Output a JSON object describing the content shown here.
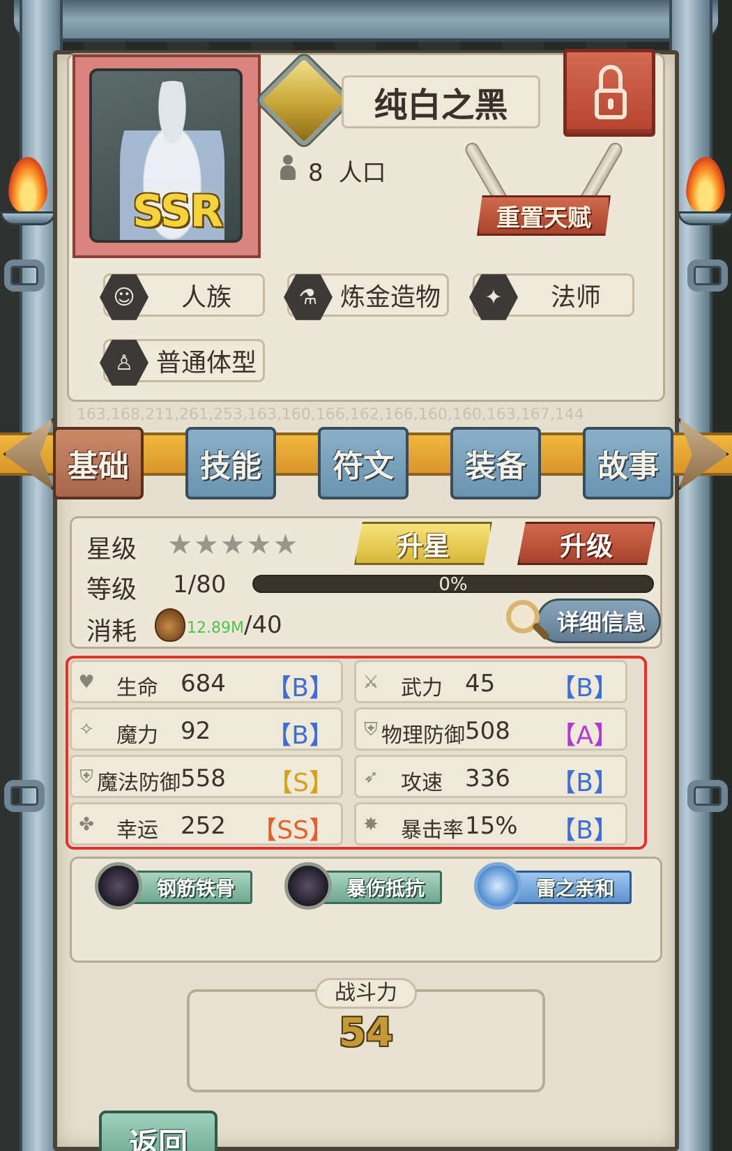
{
  "hero": {
    "rarity": "SSR",
    "name": "纯白之黑",
    "population_value": "8",
    "population_label": "人口",
    "reset_talent_label": "重置天赋",
    "tags": [
      "人族",
      "炼金造物",
      "法师",
      "普通体型"
    ]
  },
  "banner_numbers": "163,168,211,261,253,163,160,166,162,166,160,160,163,167,144",
  "tabs": [
    "基础",
    "技能",
    "符文",
    "装备",
    "故事"
  ],
  "active_tab": "基础",
  "basic": {
    "star_label": "星级",
    "stars_filled": 0,
    "stars_total": 5,
    "upgrade_star_label": "升星",
    "level_label": "等级",
    "level_value": "1/80",
    "level_up_label": "升级",
    "xp_percent_text": "0%",
    "xp_fraction": 0,
    "cost_label": "消耗",
    "cost_owned": "12.89M",
    "cost_required": "/40",
    "detail_label": "详细信息"
  },
  "stats": [
    {
      "name": "生命",
      "value": "684",
      "grade": "【B】",
      "icon": "heart-icon",
      "grade_color": "#3f6fd0"
    },
    {
      "name": "武力",
      "value": "45",
      "grade": "【B】",
      "icon": "sword-icon",
      "grade_color": "#3f6fd0"
    },
    {
      "name": "魔力",
      "value": "92",
      "grade": "【B】",
      "icon": "sparkle-icon",
      "grade_color": "#3f6fd0"
    },
    {
      "name": "物理防御",
      "value": "508",
      "grade": "【A】",
      "icon": "shield-icon",
      "grade_color": "#b03ad0"
    },
    {
      "name": "魔法防御",
      "value": "558",
      "grade": "【S】",
      "icon": "magic-shield-icon",
      "grade_color": "#d4a21c"
    },
    {
      "name": "攻速",
      "value": "336",
      "grade": "【B】",
      "icon": "attack-speed-icon",
      "grade_color": "#3f6fd0"
    },
    {
      "name": "幸运",
      "value": "252",
      "grade": "【SS】",
      "icon": "clover-icon",
      "grade_color": "#e0632c"
    },
    {
      "name": "暴击率",
      "value": "15%",
      "grade": "【B】",
      "icon": "crit-icon",
      "grade_color": "#3f6fd0"
    }
  ],
  "traits": [
    "钢筋铁骨",
    "暴伤抵抗",
    "雷之亲和"
  ],
  "combat": {
    "label": "战斗力",
    "value": "54"
  },
  "back_label": "返回"
}
